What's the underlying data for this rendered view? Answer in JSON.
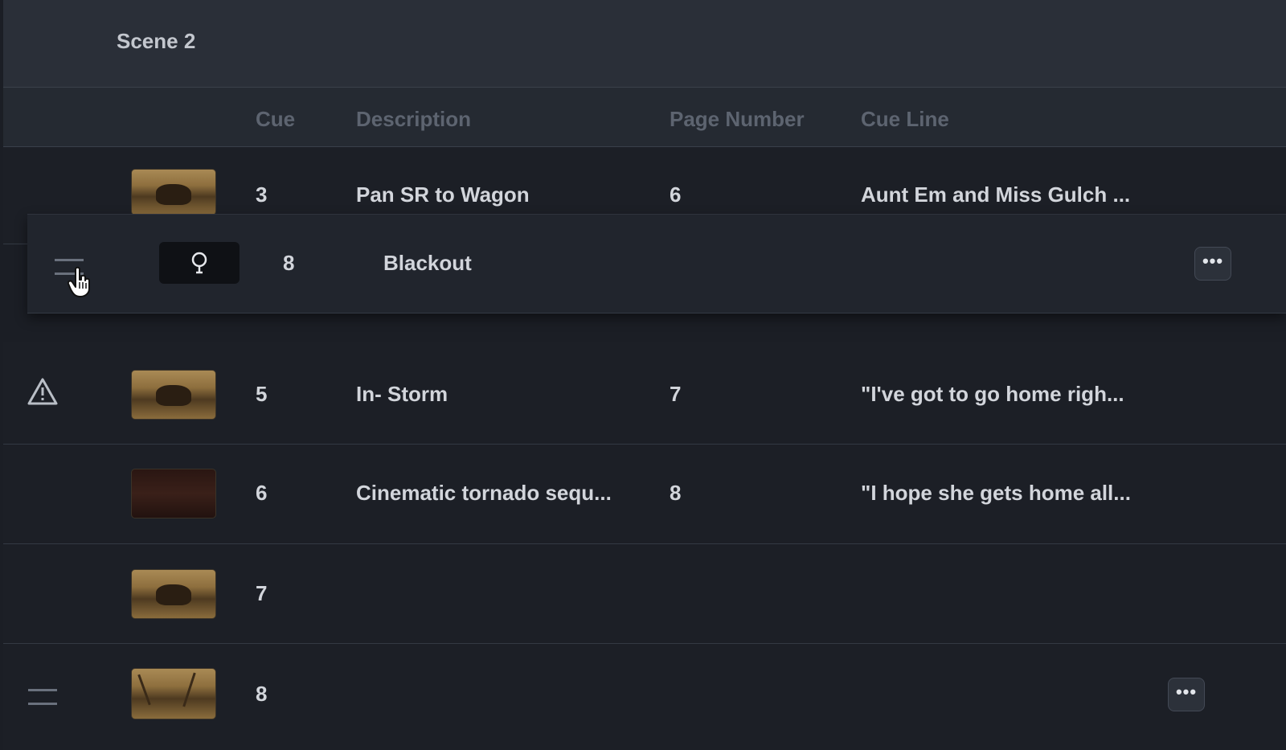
{
  "scene": {
    "title": "Scene 2"
  },
  "columns": {
    "cue": "Cue",
    "description": "Description",
    "page_number": "Page Number",
    "cue_line": "Cue Line"
  },
  "rows": [
    {
      "cue": "3",
      "description": "Pan SR to Wagon",
      "page": "6",
      "cue_line": "Aunt Em and Miss Gulch ...",
      "thumb": "wagon-sepia"
    },
    {
      "cue": "5",
      "description": "In- Storm",
      "page": "7",
      "cue_line": "\"I've got to go home righ...",
      "thumb": "wagon-sepia",
      "warning": true
    },
    {
      "cue": "6",
      "description": "Cinematic tornado sequ...",
      "page": "8",
      "cue_line": "\"I hope she gets home all...",
      "thumb": "dark-red"
    },
    {
      "cue": "7",
      "description": "",
      "page": "",
      "cue_line": "",
      "thumb": "wagon-sepia"
    },
    {
      "cue": "8",
      "description": "",
      "page": "",
      "cue_line": "",
      "thumb": "tree-sepia"
    }
  ],
  "dragging_row": {
    "cue": "8",
    "description": "Blackout",
    "icon": "lightbulb-icon"
  },
  "more_label": "•••",
  "colors": {
    "background": "#1b1e25",
    "header": "#2a2f38",
    "text": "#d2d5db",
    "muted": "#5d6470"
  }
}
